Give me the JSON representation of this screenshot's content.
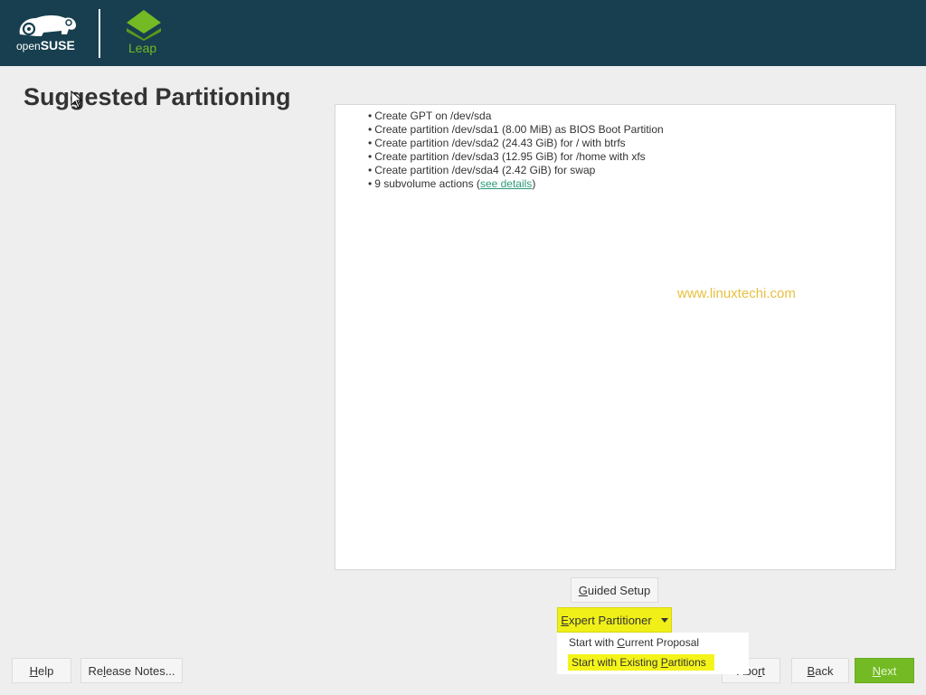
{
  "header": {
    "brand_name": "openSUSE",
    "brand_prefix": "open",
    "brand_suffix": "SUSE",
    "product_name": "Leap",
    "colors": {
      "background": "#173f4f",
      "leap_green": "#73ba25"
    }
  },
  "page": {
    "title": "Suggested Partitioning"
  },
  "actions": [
    {
      "text": "Create GPT on /dev/sda"
    },
    {
      "text": "Create partition /dev/sda1 (8.00 MiB) as BIOS Boot Partition"
    },
    {
      "text": "Create partition /dev/sda2 (24.43 GiB) for / with btrfs"
    },
    {
      "text": "Create partition /dev/sda3 (12.95 GiB) for /home with xfs"
    },
    {
      "text": "Create partition /dev/sda4 (2.42 GiB) for swap"
    },
    {
      "text_prefix": "9 subvolume actions (",
      "link": "see details",
      "text_suffix": ")"
    }
  ],
  "watermark": "www.linuxtechi.com",
  "buttons": {
    "guided_setup": {
      "mnemonic": "G",
      "rest": "uided Setup"
    },
    "expert_partitioner": {
      "mnemonic": "E",
      "rest": "xpert Partitioner",
      "highlight": "#f0f018"
    },
    "help": {
      "mnemonic": "H",
      "rest": "elp"
    },
    "release_notes": {
      "pre": "Re",
      "mnemonic": "l",
      "rest": "ease Notes..."
    },
    "abort": {
      "pre": "Abo",
      "mnemonic": "r",
      "rest": "t"
    },
    "back": {
      "mnemonic": "B",
      "rest": "ack"
    },
    "next": {
      "mnemonic": "N",
      "rest": "ext",
      "color": "#73ba25"
    }
  },
  "dropdown": {
    "items": [
      {
        "pre": "Start with ",
        "mnemonic": "C",
        "rest": "urrent Proposal",
        "highlighted": false
      },
      {
        "pre": "Start with Existing ",
        "mnemonic": "P",
        "rest": "artitions",
        "highlighted": true
      }
    ]
  }
}
